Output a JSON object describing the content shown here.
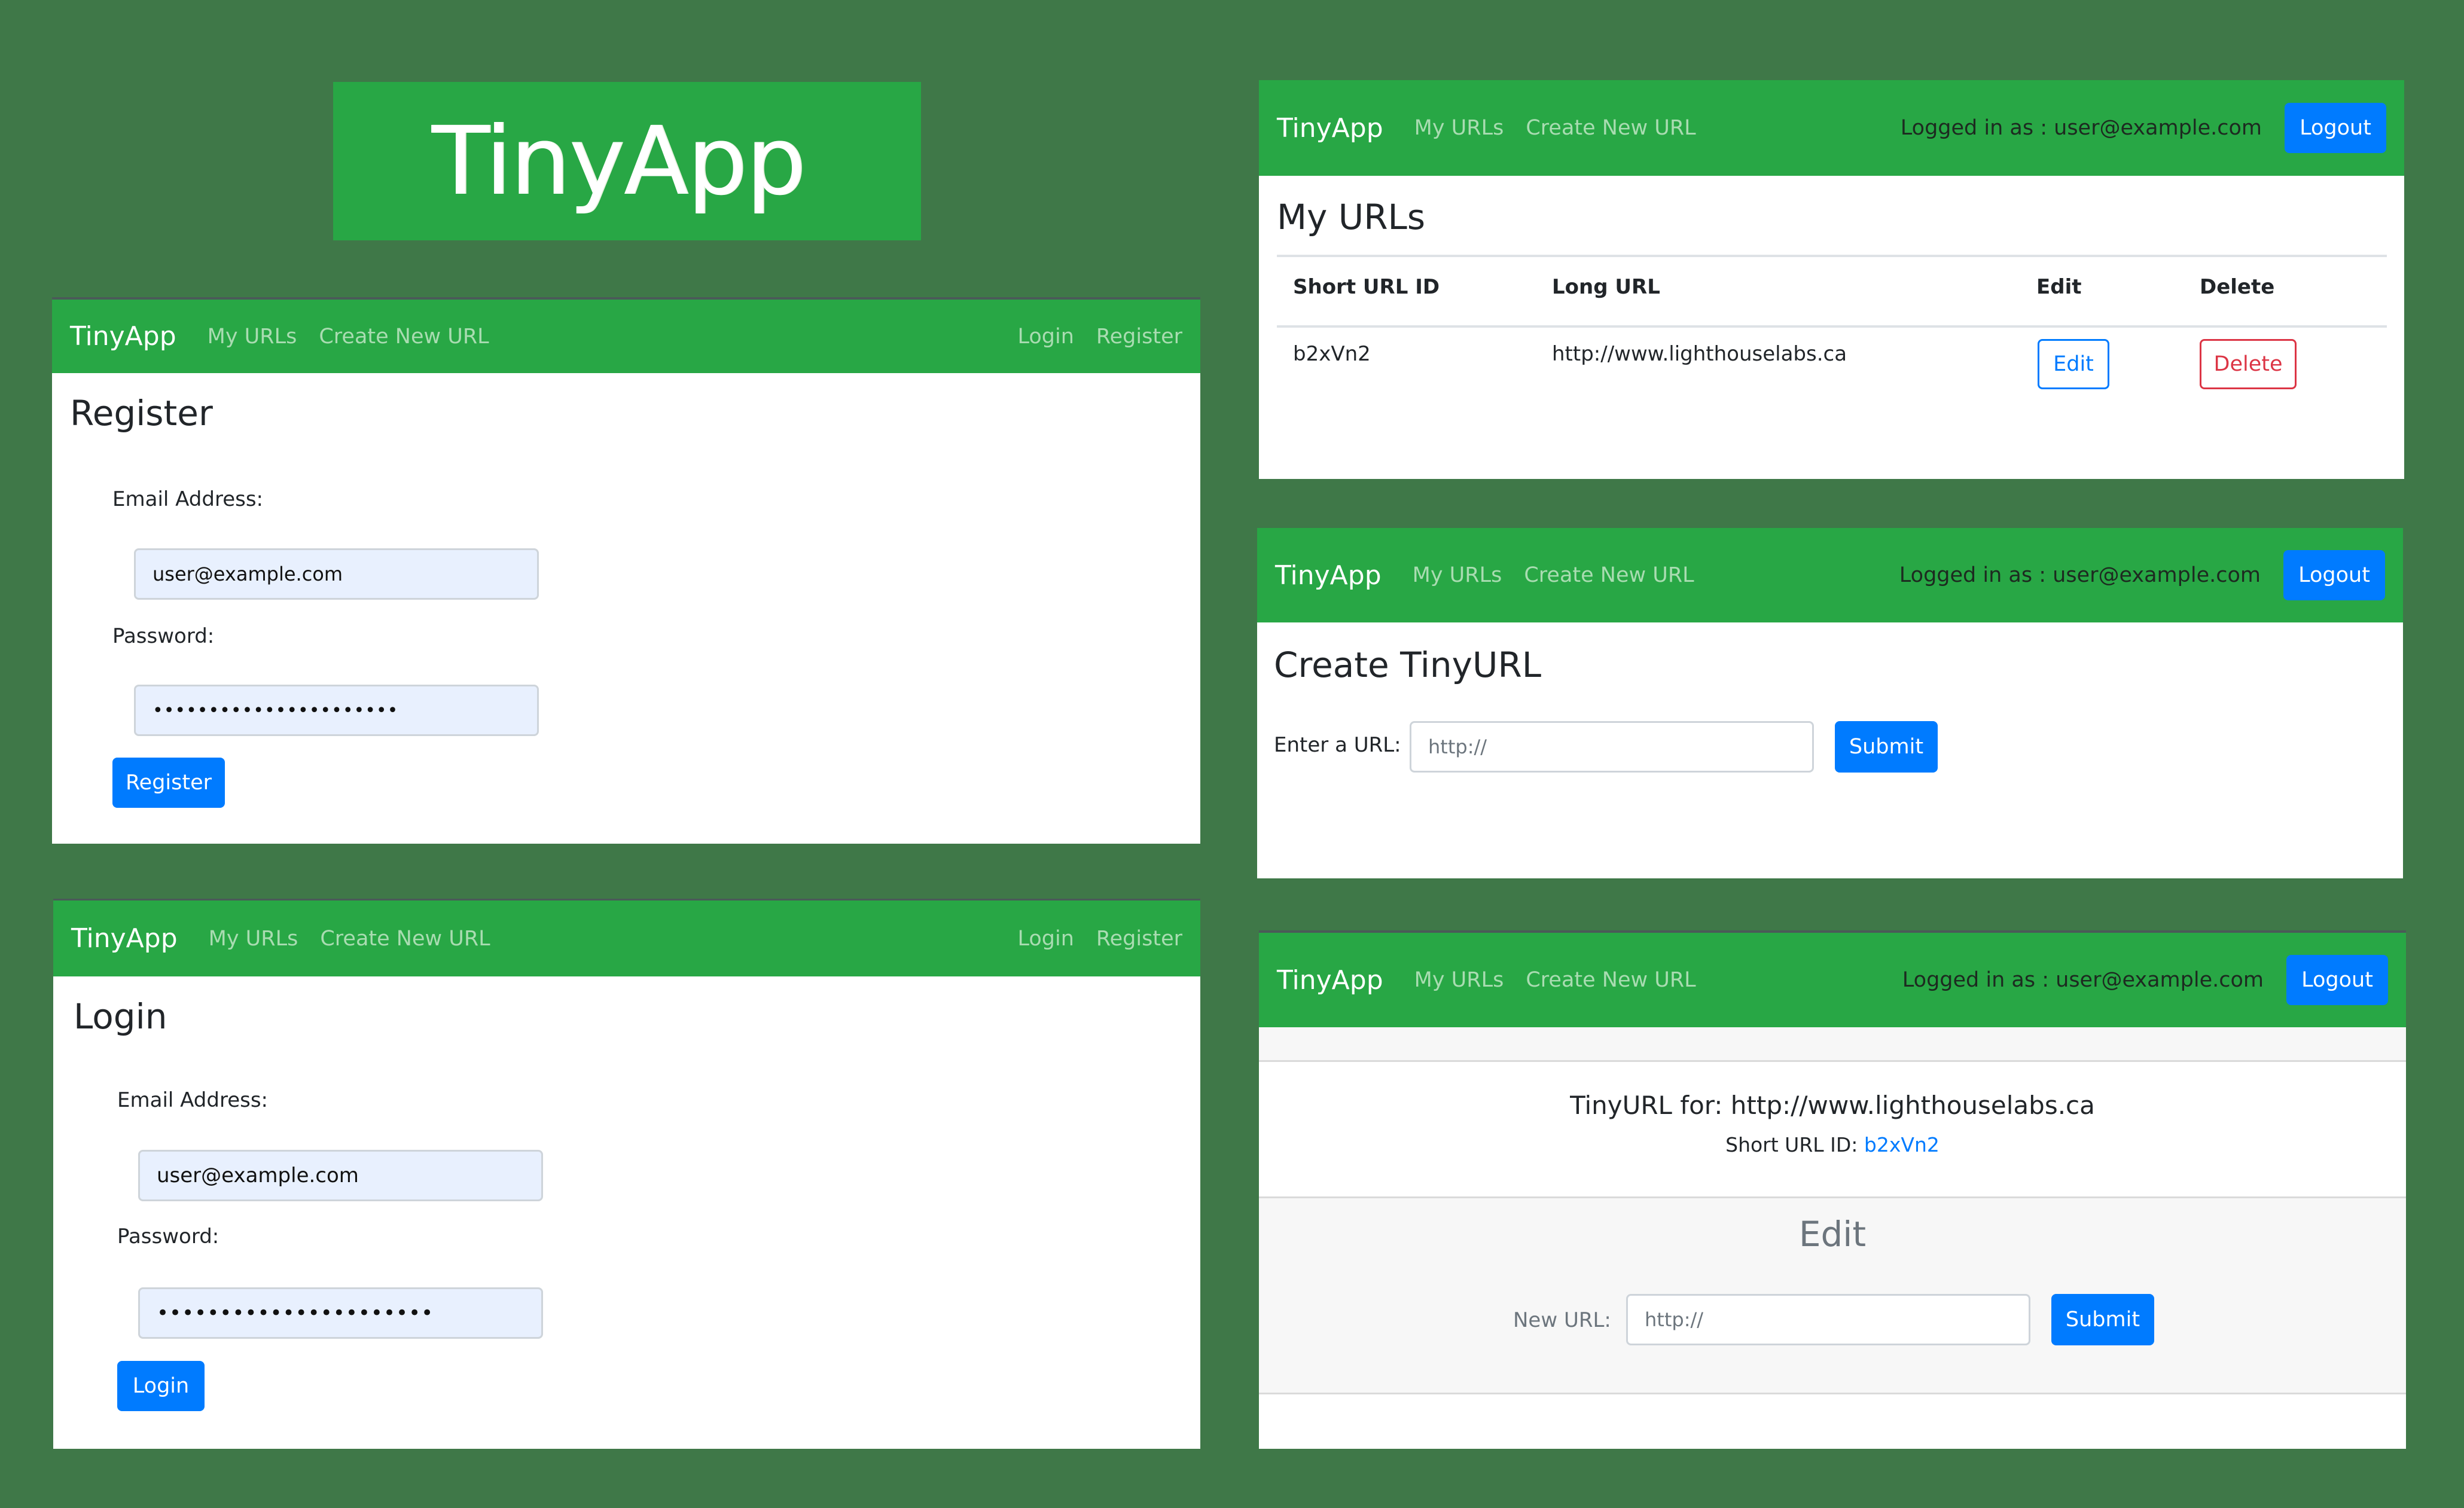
{
  "logo": {
    "text": "TinyApp"
  },
  "colors": {
    "navbar": "#28a745",
    "primary": "#007bff",
    "danger": "#dc3545",
    "background": "#3f7848"
  },
  "nav_guest": {
    "brand": "TinyApp",
    "links": [
      "My URLs",
      "Create New URL"
    ],
    "right_links": [
      "Login",
      "Register"
    ]
  },
  "nav_user": {
    "brand": "TinyApp",
    "links": [
      "My URLs",
      "Create New URL"
    ],
    "logged_in_text": "Logged in as : user@example.com",
    "logout_label": "Logout"
  },
  "register": {
    "title": "Register",
    "email_label": "Email Address:",
    "email_value": "user@example.com",
    "password_label": "Password:",
    "password_value": "••••••••••••••••••••••",
    "submit_label": "Register"
  },
  "login": {
    "title": "Login",
    "email_label": "Email Address:",
    "email_value": "user@example.com",
    "password_label": "Password:",
    "password_value": "••••••••••••••••••••••",
    "submit_label": "Login"
  },
  "my_urls": {
    "title": "My URLs",
    "columns": [
      "Short URL ID",
      "Long URL",
      "Edit",
      "Delete"
    ],
    "rows": [
      {
        "short_id": "b2xVn2",
        "long_url": "http://www.lighthouselabs.ca",
        "edit_label": "Edit",
        "delete_label": "Delete"
      }
    ]
  },
  "create": {
    "title": "Create TinyURL",
    "url_label": "Enter a URL:",
    "url_placeholder": "http://",
    "submit_label": "Submit"
  },
  "show": {
    "tinyurl_heading": "TinyURL for: http://www.lighthouselabs.ca",
    "short_id_label": "Short URL ID:",
    "short_id_value": "b2xVn2",
    "edit_title": "Edit",
    "new_url_label": "New URL:",
    "new_url_placeholder": "http://",
    "submit_label": "Submit"
  }
}
